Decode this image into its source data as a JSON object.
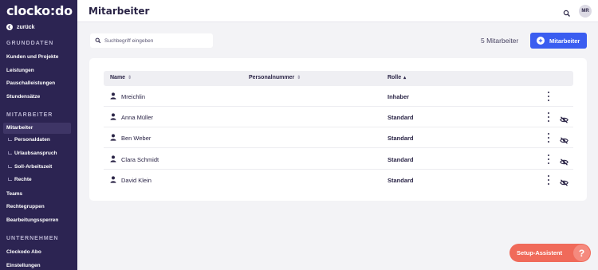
{
  "sidebar": {
    "logo": "clocko:do",
    "back_label": "zurück",
    "sections": [
      {
        "title": "GRUNDDATEN",
        "items": [
          "Kunden und Projekte",
          "Leistungen",
          "Pauschalleistungen",
          "Stundensätze"
        ]
      },
      {
        "title": "MITARBEITER",
        "active": "Mitarbeiter",
        "sub_items": [
          "Personaldaten",
          "Urlaubsanspruch",
          "Soll-Arbeitszeit",
          "Rechte"
        ],
        "items": [
          "Teams",
          "Rechtegruppen",
          "Bearbeitungssperren"
        ]
      },
      {
        "title": "UNTERNEHMEN",
        "items": [
          "Clockodo Abo",
          "Einstellungen"
        ]
      }
    ]
  },
  "header": {
    "title": "Mitarbeiter",
    "avatar_initials": "MR",
    "search_icon": "search-icon"
  },
  "toolbar": {
    "search_placeholder": "Suchbegriff eingeben",
    "count_label": "5 Mitarbeiter",
    "add_button_label": "Mitarbeiter"
  },
  "table": {
    "columns": [
      "Name",
      "Personalnummer",
      "Rolle"
    ],
    "sorted_column": "Rolle",
    "rows": [
      {
        "name": "Mreichlin",
        "personalnummer": "",
        "rolle": "Inhaber",
        "has_eye": false
      },
      {
        "name": "Anna Müller",
        "personalnummer": "",
        "rolle": "Standard",
        "has_eye": true
      },
      {
        "name": "Ben Weber",
        "personalnummer": "",
        "rolle": "Standard",
        "has_eye": true
      },
      {
        "name": "Clara Schmidt",
        "personalnummer": "",
        "rolle": "Standard",
        "has_eye": true
      },
      {
        "name": "David Klein",
        "personalnummer": "",
        "rolle": "Standard",
        "has_eye": true
      }
    ]
  },
  "setup_assistant": {
    "label": "Setup-Assistent",
    "icon_glyph": "?"
  },
  "colors": {
    "sidebar_bg": "#2c2452",
    "accent": "#3a5df0",
    "setup": "#f06a5a"
  }
}
